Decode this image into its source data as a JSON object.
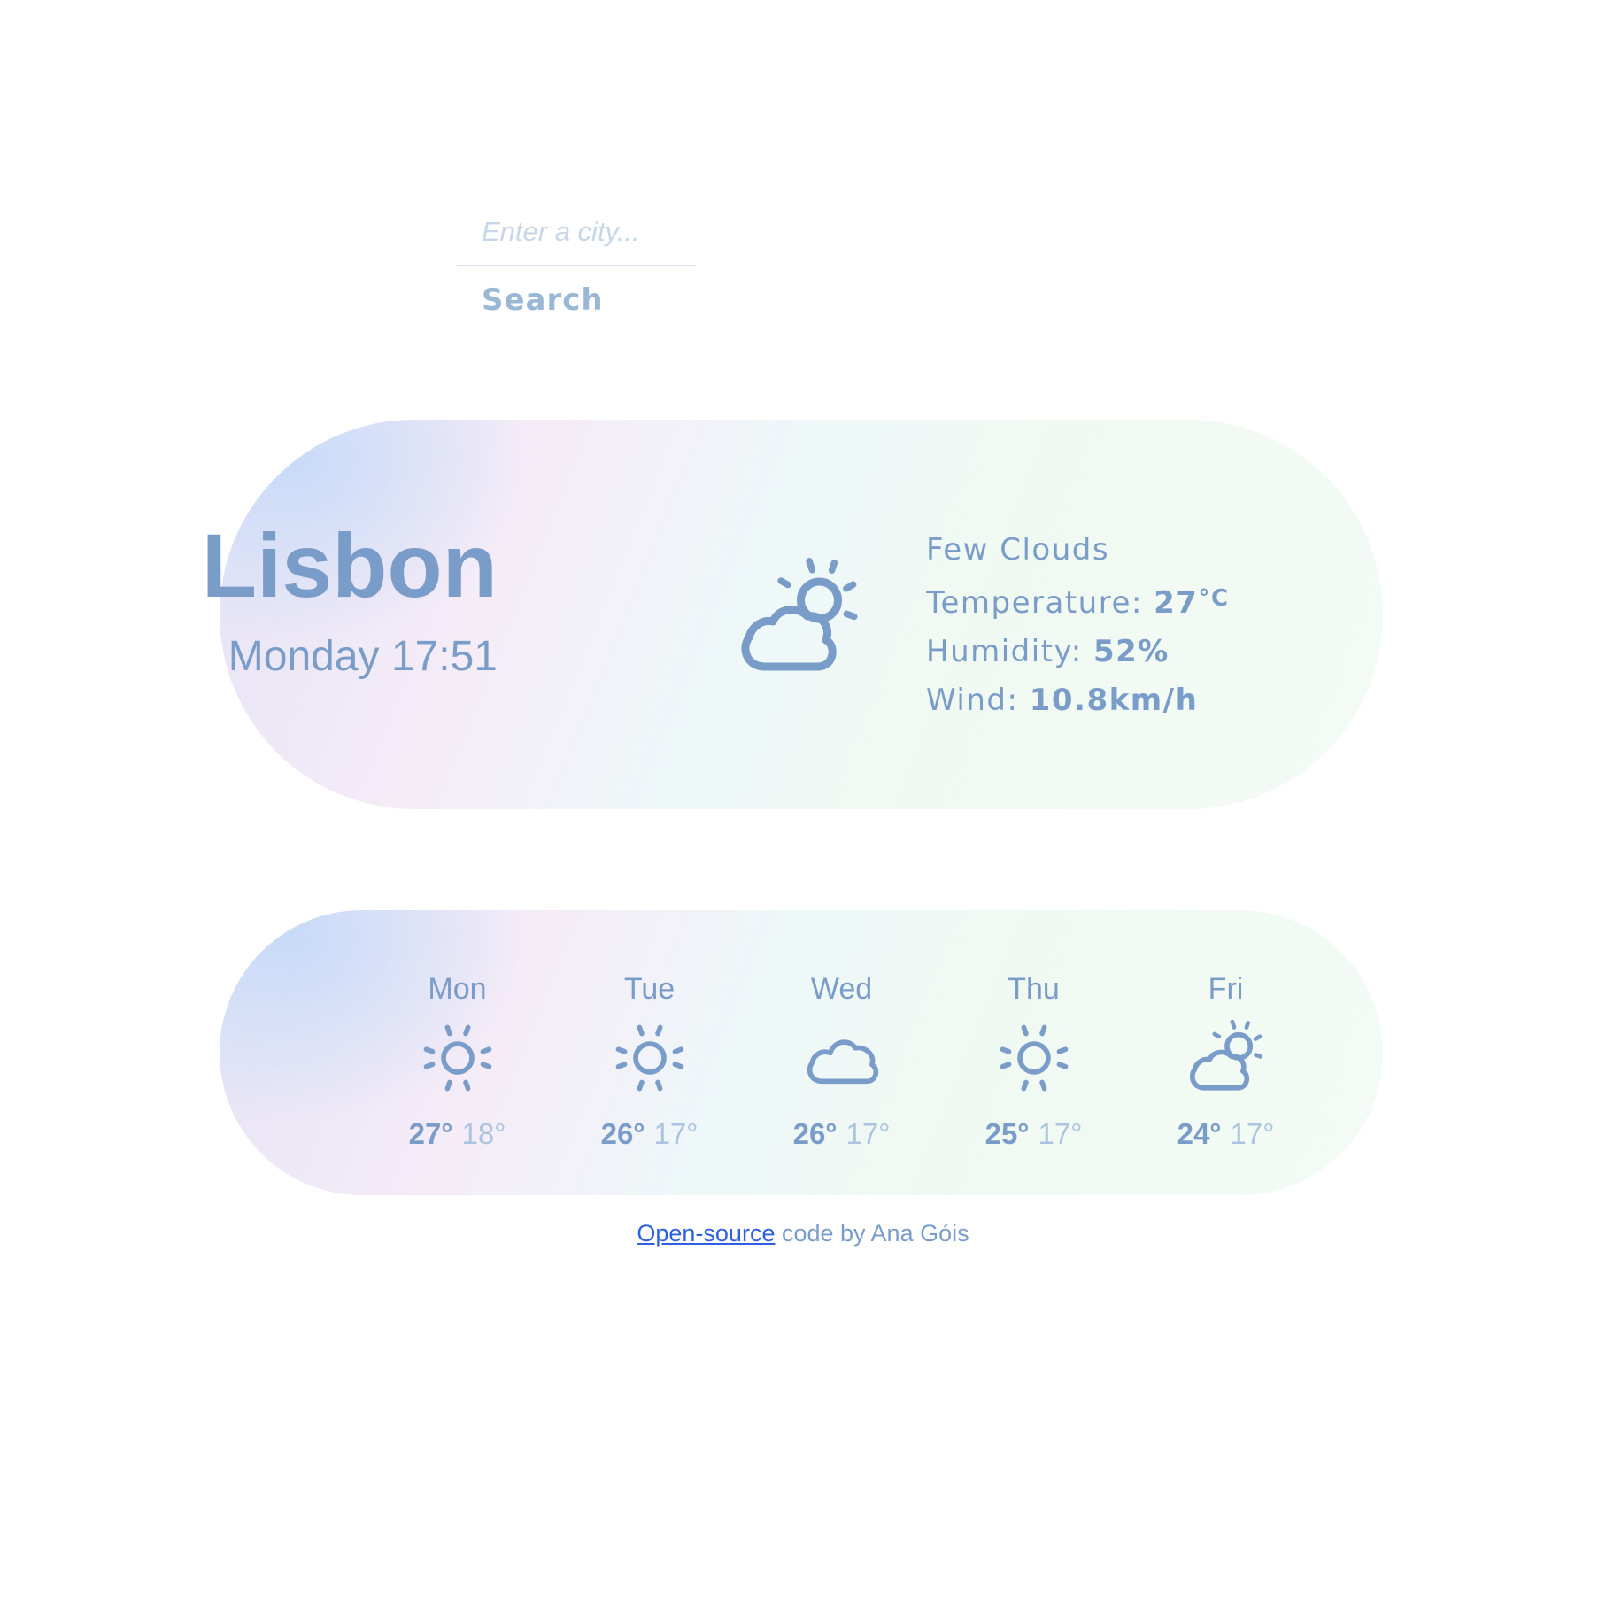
{
  "search": {
    "placeholder": "Enter a city...",
    "value": "",
    "button_label": "Search"
  },
  "current": {
    "city": "Lisbon",
    "date": "Monday 17:51",
    "icon": "few-clouds-icon",
    "description": "Few Clouds",
    "temperature_label": "Temperature:",
    "temperature_value": "27",
    "temperature_unit": "°C",
    "humidity_label": "Humidity:",
    "humidity_value": "52%",
    "wind_label": "Wind:",
    "wind_value": "10.8km/h"
  },
  "forecast": [
    {
      "day": "Mon",
      "icon": "sun-icon",
      "max": "27°",
      "min": "18°"
    },
    {
      "day": "Tue",
      "icon": "sun-icon",
      "max": "26°",
      "min": "17°"
    },
    {
      "day": "Wed",
      "icon": "cloud-icon",
      "max": "26°",
      "min": "17°"
    },
    {
      "day": "Thu",
      "icon": "sun-icon",
      "max": "25°",
      "min": "17°"
    },
    {
      "day": "Fri",
      "icon": "few-clouds-icon",
      "max": "24°",
      "min": "17°"
    }
  ],
  "footer": {
    "link_text": "Open-source",
    "suffix": " code by Ana Góis"
  },
  "colors": {
    "primary_text": "#7a9cc8",
    "muted_text": "#abc3de",
    "link": "#2d5fe0"
  }
}
